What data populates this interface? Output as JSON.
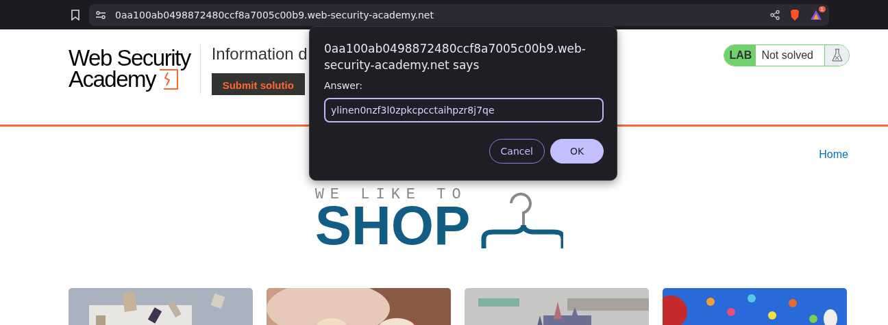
{
  "browser": {
    "url": "0aa100ab0498872480ccf8a7005c00b9.web-security-academy.net",
    "notification_count": "1"
  },
  "header": {
    "logo_line1": "Web Security",
    "logo_line2": "Academy",
    "lab_title": "Information d",
    "submit_button": "Submit solutio",
    "lab_badge": "LAB",
    "lab_status": "Not solved"
  },
  "nav": {
    "links": [
      "Home"
    ]
  },
  "shop_logo": {
    "tagline": "WE LIKE TO",
    "name": "SHOP"
  },
  "dialog": {
    "title": "0aa100ab0498872480ccf8a7005c00b9.web-security-academy.net says",
    "label": "Answer:",
    "value": "ylinen0nzf3l0zpkcpcctaihpzr8j7qe",
    "buttons": [
      {
        "label": "Cancel",
        "kind": "secondary"
      },
      {
        "label": "OK",
        "kind": "primary"
      }
    ]
  }
}
